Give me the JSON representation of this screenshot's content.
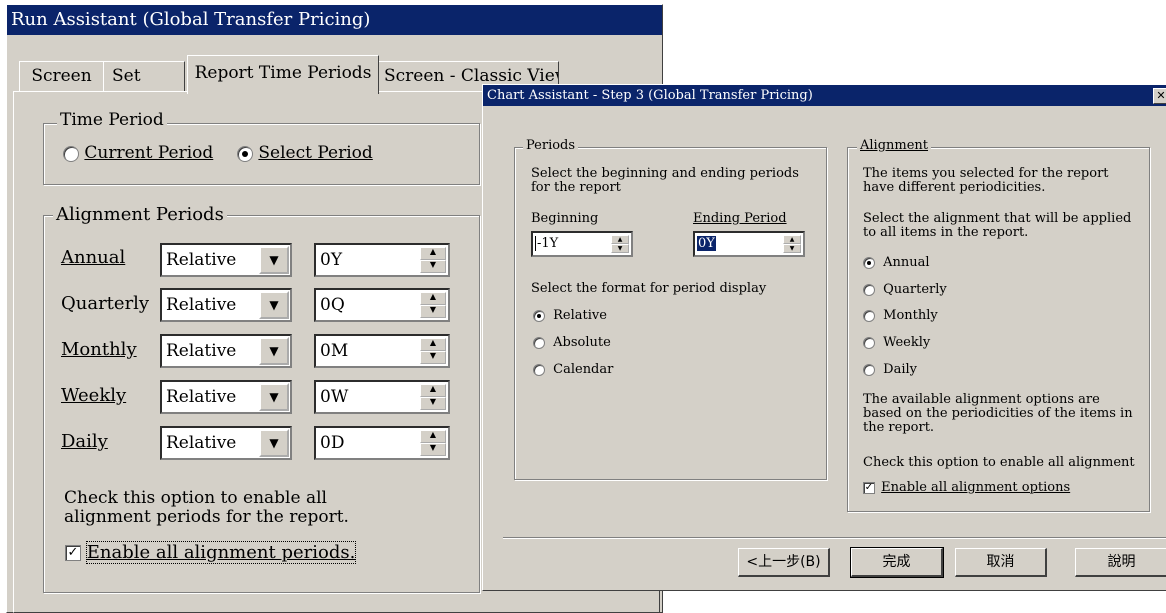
{
  "run_assistant": {
    "title": "Run Assistant   (Global Transfer Pricing)",
    "tabs": [
      "Screen",
      "Set",
      "Report Time Periods",
      "Screen - Classic View"
    ],
    "time_period": {
      "legend": "Time Period",
      "options": [
        {
          "label": "Current Period",
          "selected": false
        },
        {
          "label": "Select Period",
          "selected": true
        }
      ]
    },
    "alignment_periods": {
      "legend": "Alignment Periods",
      "rows": [
        {
          "label": "Annual",
          "mode": "Relative",
          "value": "0Y"
        },
        {
          "label": "Quarterly",
          "mode": "Relative",
          "value": "0Q"
        },
        {
          "label": "Monthly",
          "mode": "Relative",
          "value": "0M"
        },
        {
          "label": "Weekly",
          "mode": "Relative",
          "value": "0W"
        },
        {
          "label": "Daily",
          "mode": "Relative",
          "value": "0D"
        }
      ]
    },
    "note": "Check this option to enable all alignment periods for the report.",
    "checkbox": {
      "label": "Enable all alignment periods.",
      "checked": true
    }
  },
  "chart_assistant": {
    "title": "Chart Assistant - Step 3   (Global Transfer Pricing)",
    "periods": {
      "legend": "Periods",
      "instruction": "Select the beginning and ending periods for the report",
      "beginning_label": "Beginning",
      "beginning_value": "-1Y",
      "ending_label": "Ending Period",
      "ending_value": "0Y",
      "format_prompt": "Select the format for period display",
      "format_options": [
        {
          "label": "Relative",
          "selected": true
        },
        {
          "label": "Absolute",
          "selected": false
        },
        {
          "label": "Calendar",
          "selected": false
        }
      ]
    },
    "alignment": {
      "legend": "Alignment",
      "text1": "The items you selected for the report have different periodicities.",
      "text2": "Select the alignment that will be applied to all items in the report.",
      "options": [
        {
          "label": "Annual",
          "selected": true
        },
        {
          "label": "Quarterly",
          "selected": false
        },
        {
          "label": "Monthly",
          "selected": false
        },
        {
          "label": "Weekly",
          "selected": false
        },
        {
          "label": "Daily",
          "selected": false
        }
      ],
      "text3": "The available alignment options are based on the periodicities of the items in the report.",
      "text4": "Check this option to enable all alignment",
      "checkbox_label": "Enable all alignment options",
      "checkbox_checked": true
    },
    "buttons": {
      "back": "<上一步(B)",
      "finish": "完成",
      "cancel": "取消",
      "help": "說明"
    }
  },
  "colors": {
    "titlebar": "#0a246a",
    "face": "#d4d0c8",
    "selection": "#0a246a"
  }
}
